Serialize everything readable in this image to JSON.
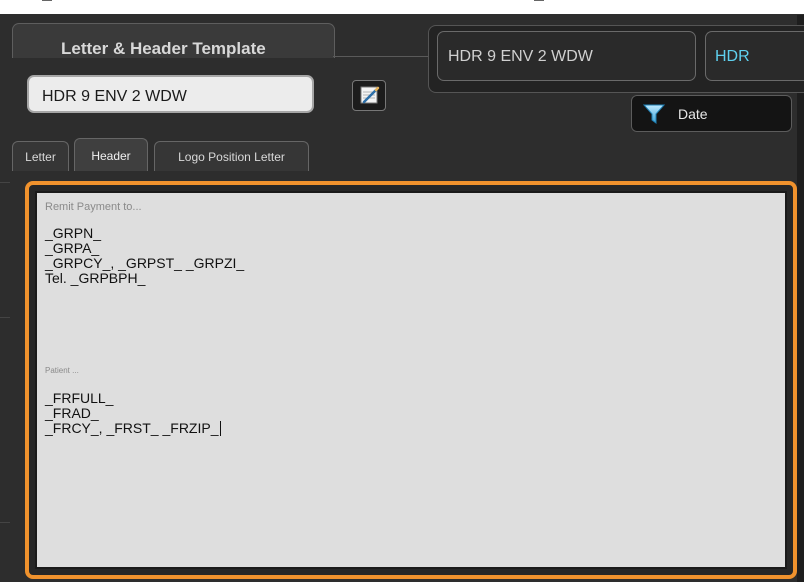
{
  "window": {
    "title": "Letter & Header Template"
  },
  "template_name_field": {
    "value": "HDR 9 ENV 2 WDW"
  },
  "right_panel": {
    "combo_value": "HDR 9 ENV 2 WDW",
    "type_badge": "HDR",
    "sort_button_label": "Date"
  },
  "tabs": [
    {
      "label": "Letter"
    },
    {
      "label": "Header"
    },
    {
      "label": "Logo Position Letter"
    }
  ],
  "active_tab": "Header",
  "editor": {
    "remit_caption": "Remit Payment to...",
    "remit_lines": [
      "_GRPN_",
      "_GRPA_",
      "_GRPCY_, _GRPST_ _GRPZI_",
      "Tel. _GRPBPH_"
    ],
    "patient_caption": "Patient ...",
    "patient_lines": [
      "_FRFULL_",
      "_FRAD_",
      "_FRCY_, _FRST_ _FRZIP_"
    ]
  },
  "colors": {
    "accent_border": "#f0922d",
    "badge_text": "#5fd0ee",
    "background": "#2d2d2d"
  },
  "icons": [
    "edit-icon",
    "filter-funnel-icon"
  ]
}
